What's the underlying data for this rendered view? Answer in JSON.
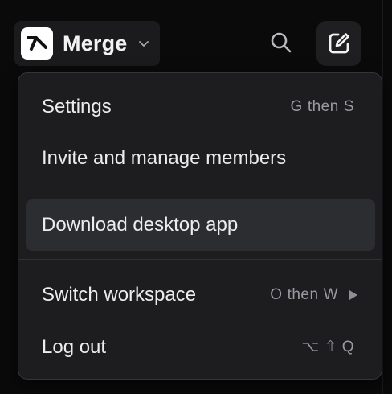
{
  "workspace": {
    "name": "Merge",
    "logo_icon": "merge-logo-icon",
    "chevron_icon": "chevron-down-icon"
  },
  "header": {
    "search_icon": "search-icon",
    "compose_icon": "compose-icon"
  },
  "menu": {
    "items": [
      {
        "label": "Settings",
        "shortcut_a": "G",
        "shortcut_then": "then",
        "shortcut_b": "S"
      },
      {
        "label": "Invite and manage members"
      },
      {
        "label": "Download desktop app",
        "highlighted": true
      },
      {
        "label": "Switch workspace",
        "shortcut_a": "O",
        "shortcut_then": "then",
        "shortcut_b": "W",
        "submenu_icon": "triangle-right-icon"
      },
      {
        "label": "Log out",
        "shortcut_keys": "⌥ ⇧ Q"
      }
    ]
  },
  "colors": {
    "background": "#0a0a0b",
    "menu_bg": "#1d1d20",
    "highlight": "#2c2d31",
    "text": "#ececef",
    "muted": "#9a9aa2"
  }
}
